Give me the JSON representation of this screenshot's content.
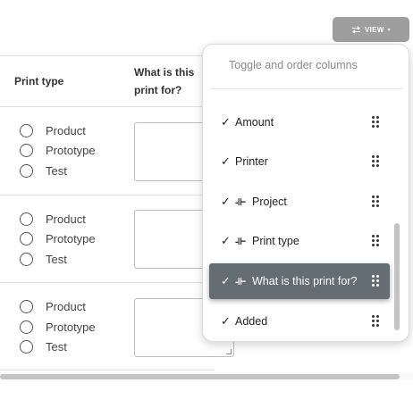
{
  "view_button": {
    "label": "VIEW",
    "icon": "swap-horizontal-icon"
  },
  "table": {
    "columns": [
      {
        "label": "Print type"
      },
      {
        "label": "What is this print for?"
      }
    ],
    "rows": [
      {
        "options": [
          "Product",
          "Prototype",
          "Test"
        ],
        "selected": null,
        "purpose_value": ""
      },
      {
        "options": [
          "Product",
          "Prototype",
          "Test"
        ],
        "selected": null,
        "purpose_value": ""
      },
      {
        "options": [
          "Product",
          "Prototype",
          "Test"
        ],
        "selected": null,
        "purpose_value": ""
      }
    ]
  },
  "column_menu": {
    "title": "Toggle and order columns",
    "items": [
      {
        "label": "Amount",
        "checked": true,
        "pinned": false
      },
      {
        "label": "Printer",
        "checked": true,
        "pinned": false
      },
      {
        "label": "Project",
        "checked": true,
        "pinned": true
      },
      {
        "label": "Print type",
        "checked": true,
        "pinned": true
      },
      {
        "label": "What is this print for?",
        "checked": true,
        "pinned": true,
        "active": true
      },
      {
        "label": "Added",
        "checked": true,
        "pinned": false
      }
    ],
    "check_glyph": "✓",
    "pin_glyph": "-⊩"
  },
  "colors": {
    "active_item": "#646c74",
    "view_button": "#9e9e9e"
  }
}
